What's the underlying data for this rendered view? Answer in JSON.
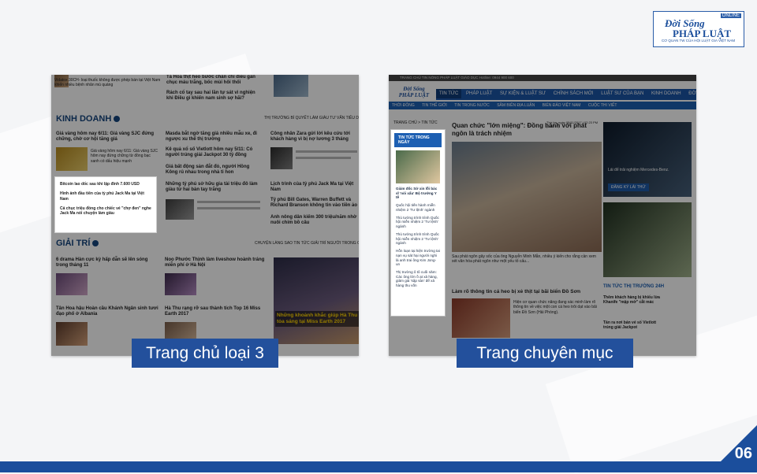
{
  "brand": {
    "online": "ONLINE",
    "line1": "Đời Sống",
    "line2": "PHÁP LUẬT",
    "tagline": "CƠ QUAN TW CỦA HỘI LUẬT GIA VIỆT NAM"
  },
  "captions": {
    "home": "Trang chủ loại 3",
    "category": "Trang chuyên mục"
  },
  "page_number": "06",
  "home": {
    "top_items": [
      "Tà Hoa thịt heo bước chấn chỉ điều gần chục máu trắng, bốc mùi hôi thối",
      "Rách cổ tay sau hai lần tự sát vì nghiện khi Điều gì khiến nam sinh sợ hãi?"
    ],
    "kinh_doanh": {
      "title": "KINH DOANH",
      "tags": "THỊ TRƯỜNG   BÍ QUYẾT LÀM GIÀU   TƯ VẤN TIÊU DÙNG",
      "lead": "Giá vàng hôm nay 6/11: Giá vàng SJC đứng chững, chờ cơ hội tăng giá",
      "lead_sub": "Giá vàng hôm nay 6/11: Giá vàng SJC hôm nay đứng chững từ đồng bạc xanh có dấu hiệu mạnh",
      "mid": [
        "Masda bắt ngờ tăng giá nhiều mẫu xe, đi ngược xu thế thị trường",
        "Kê quả xổ số Vietlott hôm nay 5/11: Có người trúng giải Jackpot 30 tỷ đồng",
        "Giá bất động sản đắt đỏ, người Hồng Kông rủ nhau trong nhà ti hon"
      ],
      "right_lead": "Công nhân Zara gửi lời kêu cứu tới khách hàng vì bị nợ lương 3 tháng",
      "highlight": [
        "Bitcoin lao dốc sau khi lập đỉnh 7.600 USD",
        "Hình ảnh đầu tiên của tỷ phú Jack Ma tại Việt Nam",
        "Cả chục triệu đồng cho chiếc vé \"chợ đen\" nghe Jack Ma nói chuyện làm giàu"
      ],
      "billionaire": "Những tỷ phú sở hữu gia tài triệu đô làm giàu từ hai bàn tay trắng",
      "list_right": [
        "Lịch trình của tỷ phú Jack Ma tại Việt Nam",
        "Tỷ phú Bill Gates, Warren Buffett và Richard Branson không tin vào tiền ảo",
        "Anh nông dân kiếm 300 triệu/năm nhờ nuôi chim bồ câu"
      ]
    },
    "giai_tri": {
      "title": "GIẢI TRÍ",
      "tags": "CHUYỆN LÀNG SAO   TIN TỨC GIẢI TRÍ   NGƯỜI TRONG CUỘC",
      "items": [
        "6 drama Hàn cực kỳ hấp dẫn sẽ lên sóng trong tháng 11",
        "Noo Phước Thịnh làm liveshow hoành tráng miễn phí ở Hà Nội",
        "Tân Hoa hậu Hoàn cầu Khánh Ngân sinh tươi đạo phố ở Albania",
        "Hà Thu rạng rỡ sau thành tích Top 16 Miss Earth 2017"
      ],
      "feature": "Những khoảnh khắc giúp Hà Thu tỏa sáng tại Miss Earth 2017"
    }
  },
  "category": {
    "topbar": "TRANG CHỦ   TIN NÓNG   PHÁP LUẬT   GIÁO DỤC   Hotline: 0944 900 600",
    "nav": [
      "TIN TỨC",
      "PHÁP LUẬT",
      "SỰ KIỆN & LUẬT SƯ",
      "CHÍNH SÁCH MỚI",
      "LUẬT SƯ CỦA BẠN",
      "KINH DOANH",
      "ĐỜI SỐNG"
    ],
    "subnav": [
      "THỜI ĐÔNG",
      "TIN THẾ GIỚI",
      "TIN TRONG NƯỚC",
      "SÂM BIÊN ĐỊA LUẬN",
      "BIỂN ĐẢO VIỆT NAM",
      "CUỘC THI VIẾT"
    ],
    "breadcrumb": "TRANG CHỦ  >  TIN TỨC",
    "highlight_title": "TIN TỨC TRONG NGÀY",
    "highlight_items": [
      "Giám đốc Sở xin lỗi bác sĩ 'nói xấu' Bộ trưởng Y tế",
      "Quốc hội tiến hành miễn nhiệm 2 'Tư lệnh' ngành",
      "Thủ tướng trình trình Quốc hội miễn nhiệm 2 'Tư lệnh' ngành",
      "Thủ tướng trình trình Quốc hội miễn nhiệm 2 'Tư lệnh' ngành",
      "Hỗn loạn tại hiện trường tai nạn vụ sát hại người nghi là anh trai ông Kim Jong-un",
      "Thị trường ô tô cuối năm: Các ông lớn ồ ạt xả hàng, giảm giá 'sập sàn' để xả hàng thu vốn"
    ],
    "lead_title": "Quan chức \"lớn miệng\": Đồng hành với phát ngôn là trách nhiệm",
    "lead_date": "Thứ ba, ngày 05/11/2017 | 02:23 PM (GMT+7)",
    "lead_summary": "Sau phát ngôn gây sốc của ông Nguyễn Minh Mẫn, nhiều ý kiến cho rằng cần xem xét văn hóa phát ngôn như một yếu tố cấu...",
    "second_title": "Làm rõ thông tin cá heo bị xẻ thịt tại bãi biển Đồ Sơn",
    "second_summary": "Hiện cơ quan chức năng đang xác minh làm rõ thông tin về việc một con cá heo trôi dạt vào bãi biển Đồ Sơn (Hải Phòng).",
    "ad_text": "Lái để trải nghiệm Mercedes-Benz.",
    "ad_button": "ĐĂNG KÝ LÁI THỬ",
    "market_title": "TIN TỨC THỊ TRƯỜNG 24H",
    "market_items": [
      "Thêm khách hàng bị khiếu lừa Khanife \"mập mờ\" cắt mác",
      "Tân ra nơi bán vé số Vietlott trúng giải Jackpot"
    ]
  }
}
